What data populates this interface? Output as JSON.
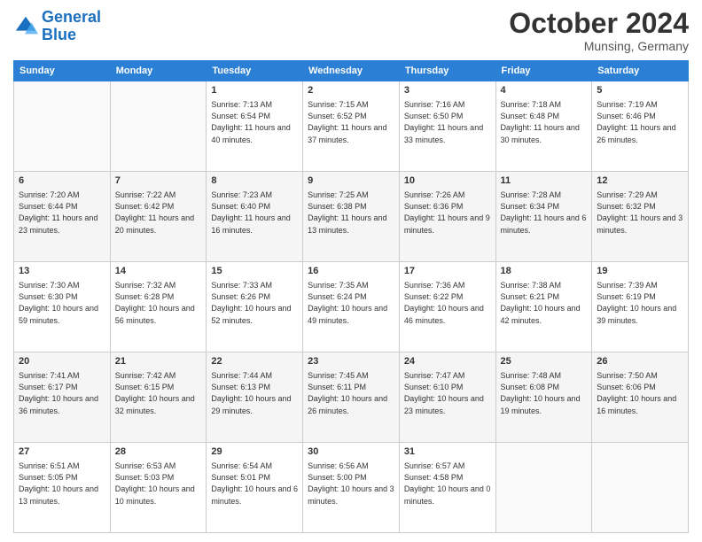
{
  "logo": {
    "line1": "General",
    "line2": "Blue"
  },
  "title": "October 2024",
  "subtitle": "Munsing, Germany",
  "headers": [
    "Sunday",
    "Monday",
    "Tuesday",
    "Wednesday",
    "Thursday",
    "Friday",
    "Saturday"
  ],
  "weeks": [
    [
      {
        "day": "",
        "info": ""
      },
      {
        "day": "",
        "info": ""
      },
      {
        "day": "1",
        "info": "Sunrise: 7:13 AM\nSunset: 6:54 PM\nDaylight: 11 hours and 40 minutes."
      },
      {
        "day": "2",
        "info": "Sunrise: 7:15 AM\nSunset: 6:52 PM\nDaylight: 11 hours and 37 minutes."
      },
      {
        "day": "3",
        "info": "Sunrise: 7:16 AM\nSunset: 6:50 PM\nDaylight: 11 hours and 33 minutes."
      },
      {
        "day": "4",
        "info": "Sunrise: 7:18 AM\nSunset: 6:48 PM\nDaylight: 11 hours and 30 minutes."
      },
      {
        "day": "5",
        "info": "Sunrise: 7:19 AM\nSunset: 6:46 PM\nDaylight: 11 hours and 26 minutes."
      }
    ],
    [
      {
        "day": "6",
        "info": "Sunrise: 7:20 AM\nSunset: 6:44 PM\nDaylight: 11 hours and 23 minutes."
      },
      {
        "day": "7",
        "info": "Sunrise: 7:22 AM\nSunset: 6:42 PM\nDaylight: 11 hours and 20 minutes."
      },
      {
        "day": "8",
        "info": "Sunrise: 7:23 AM\nSunset: 6:40 PM\nDaylight: 11 hours and 16 minutes."
      },
      {
        "day": "9",
        "info": "Sunrise: 7:25 AM\nSunset: 6:38 PM\nDaylight: 11 hours and 13 minutes."
      },
      {
        "day": "10",
        "info": "Sunrise: 7:26 AM\nSunset: 6:36 PM\nDaylight: 11 hours and 9 minutes."
      },
      {
        "day": "11",
        "info": "Sunrise: 7:28 AM\nSunset: 6:34 PM\nDaylight: 11 hours and 6 minutes."
      },
      {
        "day": "12",
        "info": "Sunrise: 7:29 AM\nSunset: 6:32 PM\nDaylight: 11 hours and 3 minutes."
      }
    ],
    [
      {
        "day": "13",
        "info": "Sunrise: 7:30 AM\nSunset: 6:30 PM\nDaylight: 10 hours and 59 minutes."
      },
      {
        "day": "14",
        "info": "Sunrise: 7:32 AM\nSunset: 6:28 PM\nDaylight: 10 hours and 56 minutes."
      },
      {
        "day": "15",
        "info": "Sunrise: 7:33 AM\nSunset: 6:26 PM\nDaylight: 10 hours and 52 minutes."
      },
      {
        "day": "16",
        "info": "Sunrise: 7:35 AM\nSunset: 6:24 PM\nDaylight: 10 hours and 49 minutes."
      },
      {
        "day": "17",
        "info": "Sunrise: 7:36 AM\nSunset: 6:22 PM\nDaylight: 10 hours and 46 minutes."
      },
      {
        "day": "18",
        "info": "Sunrise: 7:38 AM\nSunset: 6:21 PM\nDaylight: 10 hours and 42 minutes."
      },
      {
        "day": "19",
        "info": "Sunrise: 7:39 AM\nSunset: 6:19 PM\nDaylight: 10 hours and 39 minutes."
      }
    ],
    [
      {
        "day": "20",
        "info": "Sunrise: 7:41 AM\nSunset: 6:17 PM\nDaylight: 10 hours and 36 minutes."
      },
      {
        "day": "21",
        "info": "Sunrise: 7:42 AM\nSunset: 6:15 PM\nDaylight: 10 hours and 32 minutes."
      },
      {
        "day": "22",
        "info": "Sunrise: 7:44 AM\nSunset: 6:13 PM\nDaylight: 10 hours and 29 minutes."
      },
      {
        "day": "23",
        "info": "Sunrise: 7:45 AM\nSunset: 6:11 PM\nDaylight: 10 hours and 26 minutes."
      },
      {
        "day": "24",
        "info": "Sunrise: 7:47 AM\nSunset: 6:10 PM\nDaylight: 10 hours and 23 minutes."
      },
      {
        "day": "25",
        "info": "Sunrise: 7:48 AM\nSunset: 6:08 PM\nDaylight: 10 hours and 19 minutes."
      },
      {
        "day": "26",
        "info": "Sunrise: 7:50 AM\nSunset: 6:06 PM\nDaylight: 10 hours and 16 minutes."
      }
    ],
    [
      {
        "day": "27",
        "info": "Sunrise: 6:51 AM\nSunset: 5:05 PM\nDaylight: 10 hours and 13 minutes."
      },
      {
        "day": "28",
        "info": "Sunrise: 6:53 AM\nSunset: 5:03 PM\nDaylight: 10 hours and 10 minutes."
      },
      {
        "day": "29",
        "info": "Sunrise: 6:54 AM\nSunset: 5:01 PM\nDaylight: 10 hours and 6 minutes."
      },
      {
        "day": "30",
        "info": "Sunrise: 6:56 AM\nSunset: 5:00 PM\nDaylight: 10 hours and 3 minutes."
      },
      {
        "day": "31",
        "info": "Sunrise: 6:57 AM\nSunset: 4:58 PM\nDaylight: 10 hours and 0 minutes."
      },
      {
        "day": "",
        "info": ""
      },
      {
        "day": "",
        "info": ""
      }
    ]
  ]
}
